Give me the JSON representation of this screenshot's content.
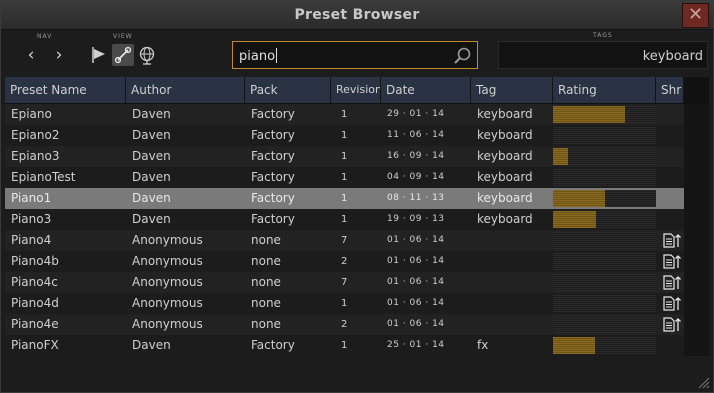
{
  "window": {
    "title": "Preset Browser",
    "close_glyph": "✕"
  },
  "nav": {
    "label": "NAV",
    "back_glyph": "‹",
    "forward_glyph": "›"
  },
  "view": {
    "label": "VIEW"
  },
  "search": {
    "value": "piano",
    "icon": "search-icon"
  },
  "tags": {
    "label": "TAGS",
    "value": "keyboard"
  },
  "columns": [
    "Preset Name",
    "Author",
    "Pack",
    "Revision",
    "Date",
    "Tag",
    "Rating",
    "Shr"
  ],
  "rows": [
    {
      "name": "Epiano",
      "author": "Daven",
      "pack": "Factory",
      "revision": "1",
      "date": "29 · 01 · 14",
      "tag": "keyboard",
      "rating": 0.7,
      "share": false
    },
    {
      "name": "Epiano2",
      "author": "Daven",
      "pack": "Factory",
      "revision": "1",
      "date": "11 · 06 · 14",
      "tag": "keyboard",
      "rating": 0,
      "share": false
    },
    {
      "name": "Epiano3",
      "author": "Daven",
      "pack": "Factory",
      "revision": "1",
      "date": "16 · 09 · 14",
      "tag": "keyboard",
      "rating": 0.15,
      "share": false
    },
    {
      "name": "EpianoTest",
      "author": "Daven",
      "pack": "Factory",
      "revision": "1",
      "date": "04 · 09 · 14",
      "tag": "keyboard",
      "rating": 0,
      "share": false
    },
    {
      "name": "Piano1",
      "author": "Daven",
      "pack": "Factory",
      "revision": "1",
      "date": "08 · 11 · 13",
      "tag": "keyboard",
      "rating": 0.5,
      "share": false,
      "selected": true
    },
    {
      "name": "Piano3",
      "author": "Daven",
      "pack": "Factory",
      "revision": "1",
      "date": "19 · 09 · 13",
      "tag": "keyboard",
      "rating": 0.42,
      "share": false
    },
    {
      "name": "Piano4",
      "author": "Anonymous",
      "pack": "none",
      "revision": "7",
      "date": "01 · 06 · 14",
      "tag": "",
      "rating": 0,
      "share": true
    },
    {
      "name": "Piano4b",
      "author": "Anonymous",
      "pack": "none",
      "revision": "2",
      "date": "01 · 06 · 14",
      "tag": "",
      "rating": 0,
      "share": true
    },
    {
      "name": "Piano4c",
      "author": "Anonymous",
      "pack": "none",
      "revision": "7",
      "date": "01 · 06 · 14",
      "tag": "",
      "rating": 0,
      "share": true
    },
    {
      "name": "Piano4d",
      "author": "Anonymous",
      "pack": "none",
      "revision": "1",
      "date": "01 · 06 · 14",
      "tag": "",
      "rating": 0,
      "share": true
    },
    {
      "name": "Piano4e",
      "author": "Anonymous",
      "pack": "none",
      "revision": "2",
      "date": "01 · 06 · 14",
      "tag": "",
      "rating": 0,
      "share": true
    },
    {
      "name": "PianoFX",
      "author": "Daven",
      "pack": "Factory",
      "revision": "1",
      "date": "25 · 01 · 14",
      "tag": "fx",
      "rating": 0.41,
      "share": false
    }
  ],
  "colors": {
    "accent": "#c58a2b",
    "rating_fill": "#8a6a1e",
    "header_bg": "#2a3344",
    "selected_row": "#7a7a7a",
    "close_bg": "#6e2a22"
  }
}
